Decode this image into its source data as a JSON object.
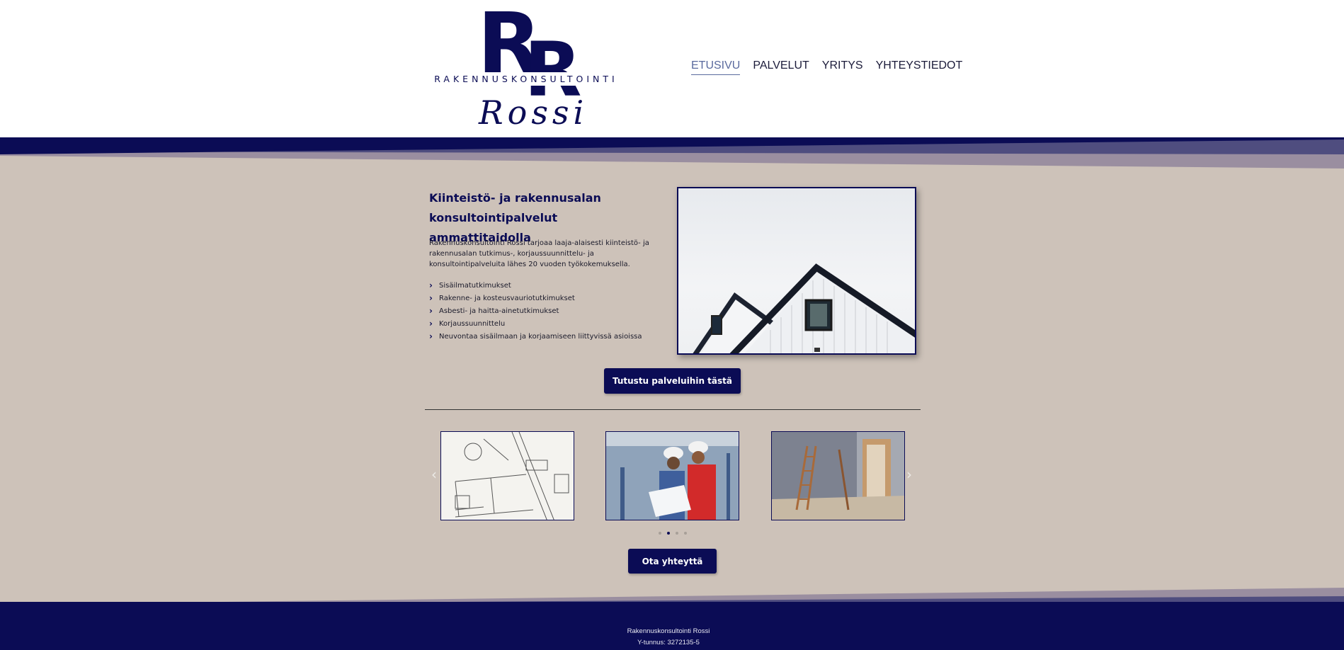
{
  "brand": {
    "initials_1": "R",
    "initials_2": "R",
    "wordmark": "RAKENNUSKONSULTOINTI",
    "script": "Rossi"
  },
  "nav": {
    "items": [
      {
        "label": "ETUSIVU",
        "active": true
      },
      {
        "label": "PALVELUT",
        "active": false
      },
      {
        "label": "YRITYS",
        "active": false
      },
      {
        "label": "YHTEYSTIEDOT",
        "active": false
      }
    ]
  },
  "hero": {
    "title": "Kiinteistö- ja rakennusalan konsultointipalvelut ammattitaidolla",
    "text": "Rakennuskonsultointi Rossi tarjoaa laaja-alaisesti kiinteistö- ja rakennusalan tutkimus-, korjaussuunnittelu- ja konsultointipalveluita  lähes 20 vuoden työkokemuksella.",
    "list": [
      "Sisäilmatutkimukset",
      "Rakenne- ja kosteusvauriotutkimukset",
      "Asbesti- ja haitta-ainetutkimukset",
      "Korjaussuunnittelu",
      "Neuvontaa sisäilmaan ja korjaamiseen liittyvissä asioissa"
    ],
    "button": "Tutustu palveluihin tästä"
  },
  "carousel": {
    "prev_icon": "chevron-left-icon",
    "next_icon": "chevron-right-icon",
    "slides": [
      "blueprint-image",
      "workers-image",
      "renovation-image"
    ],
    "dot_count": 4,
    "active_dot": 1
  },
  "contact_button": "Ota yhteyttä",
  "footer": {
    "company": "Rakennuskonsultointi Rossi",
    "business_id": "Y-tunnus: 3272135-5"
  },
  "colors": {
    "navy": "#0b0c55",
    "beige": "#cdc2b9",
    "active_link": "#5a6a9e"
  }
}
